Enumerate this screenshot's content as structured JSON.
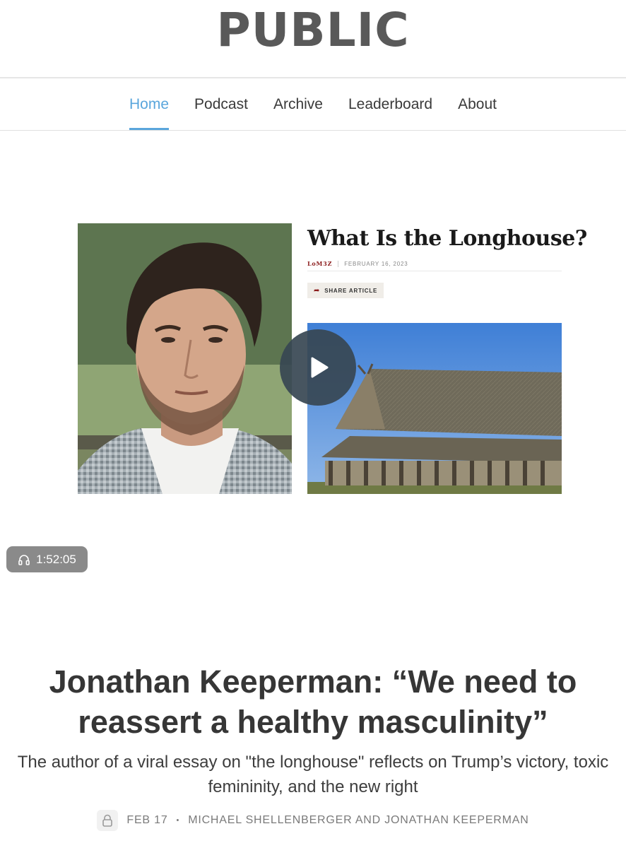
{
  "site": {
    "logo_text": "PUBLIC"
  },
  "nav": {
    "items": [
      {
        "label": "Home",
        "active": true
      },
      {
        "label": "Podcast",
        "active": false
      },
      {
        "label": "Archive",
        "active": false
      },
      {
        "label": "Leaderboard",
        "active": false
      },
      {
        "label": "About",
        "active": false
      }
    ]
  },
  "media": {
    "article_card": {
      "title": "What Is the Longhouse?",
      "author": "LoM3Z",
      "date": "FEBRUARY 16, 2023",
      "share_label": "SHARE ARTICLE"
    },
    "play_icon": "play-icon",
    "duration": "1:52:05",
    "duration_icon": "headphones-icon"
  },
  "post": {
    "title": "Jonathan Keeperman: “We need to reassert a healthy masculinity”",
    "subtitle": "The author of a viral essay on \"the longhouse\" reflects on Trump’s victory, toxic femininity, and the new right",
    "date": "FEB 17",
    "separator": "•",
    "authors": "MICHAEL SHELLENBERGER AND JONATHAN KEEPERMAN",
    "lock_icon": "lock-icon"
  },
  "colors": {
    "accent": "#5aa6dc",
    "logo": "#595959",
    "author_red": "#8b1c1c",
    "pill_bg": "#8a8a8a",
    "play_bg": "#374652"
  }
}
